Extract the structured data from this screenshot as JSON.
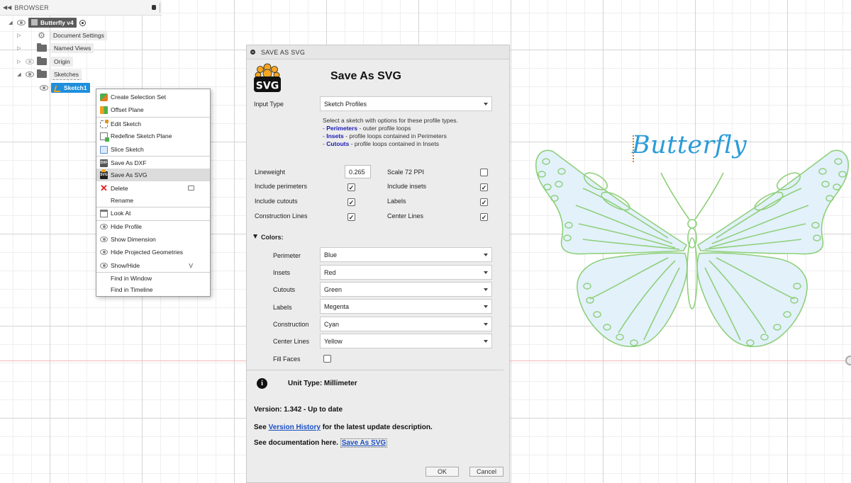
{
  "browser": {
    "collapse_glyph": "◀◀",
    "title": "BROWSER",
    "tree": [
      {
        "label": "Butterfly v4",
        "icon": "document-icon"
      },
      {
        "label": "Document Settings",
        "icon": "gear-icon"
      },
      {
        "label": "Named Views",
        "icon": "folder-icon"
      },
      {
        "label": "Origin",
        "icon": "folder-icon"
      },
      {
        "label": "Sketches",
        "icon": "folder-icon"
      },
      {
        "label": "Sketch1",
        "icon": "sketch-icon"
      }
    ]
  },
  "context_menu": {
    "items": [
      {
        "label": "Create Selection Set",
        "icon": "selection-set-icon"
      },
      {
        "label": "Offset Plane",
        "icon": "offset-plane-icon"
      },
      {
        "label": "Edit Sketch",
        "icon": "edit-sketch-icon"
      },
      {
        "label": "Redefine Sketch Plane",
        "icon": "redefine-plane-icon"
      },
      {
        "label": "Slice Sketch",
        "icon": "slice-icon"
      },
      {
        "label": "Save As DXF",
        "icon": "dxf-icon"
      },
      {
        "label": "Save As SVG",
        "icon": "svg-icon"
      },
      {
        "label": "Delete",
        "icon": "delete-icon"
      },
      {
        "label": "Rename",
        "icon": ""
      },
      {
        "label": "Look At",
        "icon": "look-at-icon"
      },
      {
        "label": "Hide Profile",
        "icon": "eye-icon"
      },
      {
        "label": "Show Dimension",
        "icon": "eye-icon"
      },
      {
        "label": "Hide Projected Geometries",
        "icon": "eye-icon"
      },
      {
        "label": "Show/Hide",
        "icon": "eye-icon",
        "shortcut": "V"
      },
      {
        "label": "Find in Window",
        "icon": ""
      },
      {
        "label": "Find in Timeline",
        "icon": ""
      }
    ]
  },
  "dialog": {
    "titlebar": "SAVE AS SVG",
    "logo_text": "SVG",
    "heading": "Save As SVG",
    "input_type": {
      "label": "Input Type",
      "value": "Sketch Profiles"
    },
    "help": {
      "intro": "Select a sketch with options for these profile types.",
      "dash": "-",
      "lines": [
        {
          "term": "Perimeters",
          "desc": " - outer profile loops"
        },
        {
          "term": "Insets",
          "desc": " - profile loops contained in Perimeters"
        },
        {
          "term": "Cutouts",
          "desc": " - profile loops contained in Insets"
        }
      ]
    },
    "lineweight": {
      "label": "Lineweight",
      "value": "0.265"
    },
    "options": [
      {
        "label": "Scale 72 PPI",
        "checked": false
      },
      {
        "label": "Include perimeters",
        "checked": true
      },
      {
        "label": "Include insets",
        "checked": true
      },
      {
        "label": "Include cutouts",
        "checked": true
      },
      {
        "label": "Labels",
        "checked": true
      },
      {
        "label": "Construction Lines",
        "checked": true
      },
      {
        "label": "Center Lines",
        "checked": true
      }
    ],
    "colors_header": "Colors:",
    "colors": [
      {
        "label": "Perimeter",
        "value": "Blue"
      },
      {
        "label": "Insets",
        "value": "Red"
      },
      {
        "label": "Cutouts",
        "value": "Green"
      },
      {
        "label": "Labels",
        "value": "Megenta"
      },
      {
        "label": "Construction",
        "value": "Cyan"
      },
      {
        "label": "Center Lines",
        "value": "Yellow"
      }
    ],
    "fill_faces": {
      "label": "Fill Faces",
      "checked": false
    },
    "unit_type": "Unit Type: Millimeter",
    "version": "Version: 1.342 - Up to date",
    "history": {
      "pre": "See ",
      "link": "Version History",
      "post": " for the latest update description."
    },
    "docs": {
      "pre": "See documentation here. ",
      "link": "Save As SVG"
    },
    "ok_label": "OK",
    "cancel_label": "Cancel"
  },
  "canvas": {
    "butterfly_label": "Butterfly",
    "outline_color": "#8ed07a",
    "fill_color": "#e3f1fb",
    "label_color": "#2b9bd8"
  }
}
